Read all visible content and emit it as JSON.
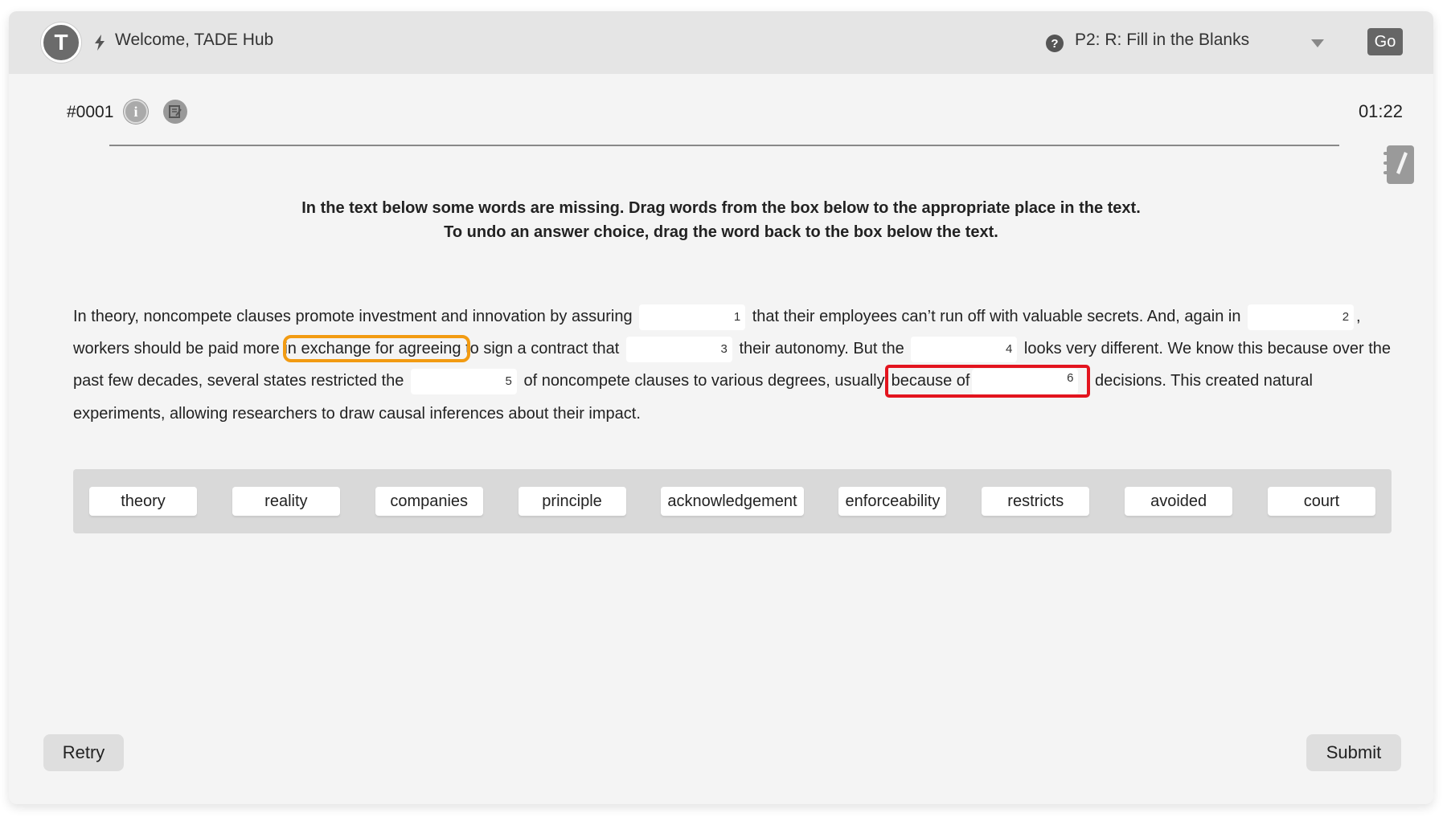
{
  "header": {
    "avatar_letter": "T",
    "welcome": "Welcome, TADE Hub",
    "task_selector": "P2: R: Fill in the Blanks",
    "go_label": "Go"
  },
  "question": {
    "number": "#0001",
    "timer": "01:22"
  },
  "instructions": {
    "line1": "In the text below some words are missing. Drag words from the box below to the appropriate place in the text.",
    "line2": "To undo an answer choice, drag the word back to the box below the text."
  },
  "passage": {
    "seg1": "In theory, noncompete clauses promote investment and innovation by assuring",
    "seg2": "that their employees can’t run off with valuable secrets. And, again in",
    "seg3": ", workers should be paid more i",
    "seg3_highlight": "n exchange for agreeing ",
    "seg4": "to sign a contract that",
    "seg5": "their autonomy. But the",
    "seg6": "looks very different. We know this because over the past few decades, several states restricted the",
    "seg7": "of noncompete clauses to various degrees, usually",
    "seg7_highlight": "because of",
    "seg8": "decisions. This created natural experiments, allowing researchers to draw causal inferences about their impact.",
    "blanks": [
      "1",
      "2",
      "3",
      "4",
      "5",
      "6"
    ]
  },
  "word_bank": [
    "theory",
    "reality",
    "companies",
    "principle",
    "acknowledgement",
    "enforceability",
    "restricts",
    "avoided",
    "court"
  ],
  "footer": {
    "retry_label": "Retry",
    "submit_label": "Submit"
  },
  "colors": {
    "highlight_orange": "#f29b12",
    "highlight_red": "#e3141e"
  }
}
